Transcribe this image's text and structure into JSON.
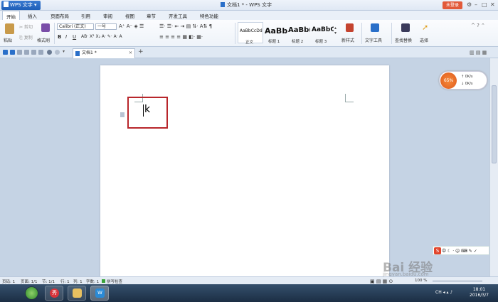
{
  "app": {
    "brand": "WPS 文字",
    "window_title": "文档1 * - WPS 文字",
    "login": "未登录"
  },
  "menu": [
    "开始",
    "插入",
    "页面布局",
    "引用",
    "审阅",
    "视图",
    "章节",
    "开发工具",
    "特色功能"
  ],
  "ribbon": {
    "paste": "粘贴",
    "cut": "剪切",
    "copy": "复制",
    "format_painter": "格式刷",
    "font_name": "Calibri (正文)",
    "font_size": "一号",
    "styles": [
      {
        "sample": "AaBbCcDd",
        "name": "正文"
      },
      {
        "sample": "AaBb",
        "name": "标题 1"
      },
      {
        "sample": "AaBb(",
        "name": "标题 2"
      },
      {
        "sample": "AaBbC",
        "name": "标题 3"
      }
    ],
    "new_style": "新样式",
    "text_tools": "文字工具",
    "find_replace": "查找替换",
    "select": "选择"
  },
  "doc_tab": "文档1 *",
  "document": {
    "text": "k"
  },
  "speed_widget": {
    "percent": "65%",
    "up": "0K/s",
    "down": "0K/s"
  },
  "ime": "中",
  "status": {
    "page_num": "页码: 1",
    "pages": "页面: 1/1",
    "section": "节: 1/1",
    "row": "行: 1",
    "col": "列: 1",
    "words": "字数: 1",
    "spell": "拼写检查",
    "zoom": "100 %"
  },
  "watermark": {
    "text": "Bai 经验",
    "url": "jingyan.baidu.com"
  },
  "taskbar": {
    "time": "18:01",
    "date": "2016/3/7",
    "tray": "CH"
  },
  "colors": {
    "accent": "#1e5fb8",
    "highlight": "#b8262b",
    "login": "#e25a3a"
  }
}
